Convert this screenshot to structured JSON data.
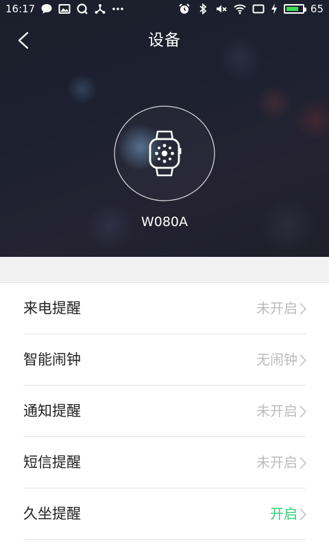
{
  "status_bar": {
    "time": "16:17",
    "battery_level": "65",
    "left_icons": [
      "chat-bubble-icon",
      "image-icon",
      "q-app-icon",
      "network-share-icon",
      "more-dots-icon"
    ],
    "right_icons": [
      "alarm-icon",
      "bluetooth-icon",
      "mute-icon",
      "wifi-icon",
      "screen-icon",
      "charging-bolt-icon",
      "battery-icon"
    ]
  },
  "header": {
    "title": "设备",
    "back_icon": "chevron-left-icon"
  },
  "device": {
    "name": "W080A",
    "icon": "smartwatch-icon"
  },
  "settings": [
    {
      "label": "来电提醒",
      "value": "未开启",
      "enabled": false
    },
    {
      "label": "智能闹钟",
      "value": "无闹钟",
      "enabled": false
    },
    {
      "label": "通知提醒",
      "value": "未开启",
      "enabled": false
    },
    {
      "label": "短信提醒",
      "value": "未开启",
      "enabled": false
    },
    {
      "label": "久坐提醒",
      "value": "开启",
      "enabled": true
    }
  ],
  "colors": {
    "enabled_text": "#2fcf73",
    "disabled_text": "#bbbbbb",
    "battery_fill": "#3ddc53"
  }
}
